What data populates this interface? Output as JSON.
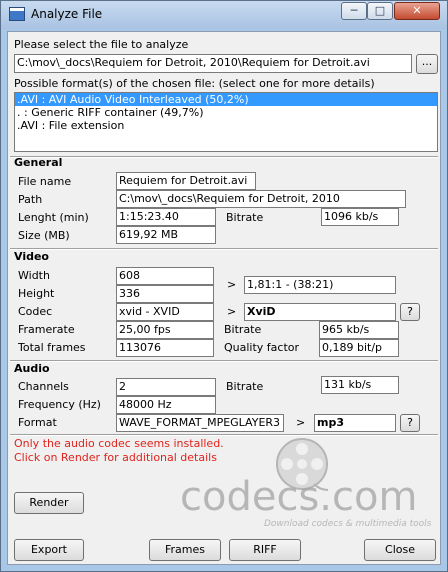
{
  "window": {
    "title": "Analyze File",
    "minimize_glyph": "─",
    "maximize_glyph": "□",
    "close_glyph": "✕"
  },
  "file_select": {
    "prompt": "Please select the file to analyze",
    "path_value": "C:\\mov\\_docs\\Requiem for Detroit, 2010\\Requiem for Detroit.avi",
    "browse_label": "..."
  },
  "formats": {
    "prompt": "Possible format(s) of the chosen file: (select one for more details)",
    "items": [
      ".AVI : AVI Audio Video Interleaved (50,2%)",
      ". : Generic RIFF container (49,7%)",
      ".AVI : File extension"
    ]
  },
  "general": {
    "heading": "General",
    "file_name_label": "File name",
    "file_name_value": "Requiem for Detroit.avi",
    "path_label": "Path",
    "path_value": "C:\\mov\\_docs\\Requiem for Detroit, 2010",
    "length_label": "Lenght (min)",
    "length_value": "1:15:23.40",
    "bitrate_label": "Bitrate",
    "bitrate_value": "1096 kb/s",
    "size_label": "Size (MB)",
    "size_value": "619,92 MB"
  },
  "video": {
    "heading": "Video",
    "width_label": "Width",
    "width_value": "608",
    "height_label": "Height",
    "height_value": "336",
    "aspect_arrow": ">",
    "aspect_value": "1,81:1 - (38:21)",
    "codec_label": "Codec",
    "codec_value": "xvid - XVID",
    "codec_arrow": ">",
    "codec_name": "XviD",
    "codec_help": "?",
    "framerate_label": "Framerate",
    "framerate_value": "25,00 fps",
    "bitrate_label": "Bitrate",
    "bitrate_value": "965 kb/s",
    "total_frames_label": "Total frames",
    "total_frames_value": "113076",
    "quality_label": "Quality factor",
    "quality_value": "0,189 bit/p"
  },
  "audio": {
    "heading": "Audio",
    "channels_label": "Channels",
    "channels_value": "2",
    "bitrate_label": "Bitrate",
    "bitrate_value": "131 kb/s",
    "frequency_label": "Frequency (Hz)",
    "frequency_value": "48000 Hz",
    "format_label": "Format",
    "format_value": "WAVE_FORMAT_MPEGLAYER3",
    "format_arrow": ">",
    "codec_name": "mp3",
    "codec_help": "?"
  },
  "warning": {
    "line1": "Only the audio codec seems installed.",
    "line2": "Click on Render for additional details"
  },
  "watermark": {
    "brand": "codecs.com",
    "tagline": "Download codecs & multimedia tools"
  },
  "buttons": {
    "render": "Render",
    "export": "Export",
    "frames": "Frames",
    "riff": "RIFF",
    "close": "Close"
  }
}
